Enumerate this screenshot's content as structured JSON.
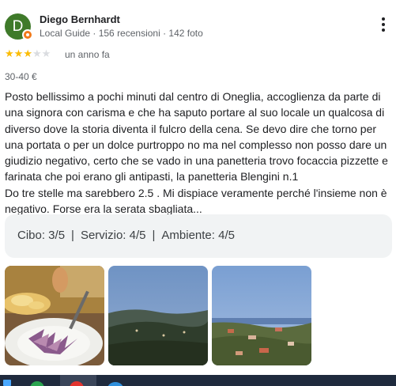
{
  "reviewer": {
    "initial": "D",
    "name": "Diego Bernhardt",
    "meta": "Local Guide · 156 recensioni · 142 foto",
    "avatar_color": "#3f7a2a",
    "badge_color": "#f27a1a"
  },
  "review": {
    "rating": 3,
    "rating_max": 5,
    "star_color": "#fbbc04",
    "time": "un anno fa",
    "price": "30-40 €",
    "text_lines": [
      "Posto bellissimo a pochi minuti dal centro di Oneglia, accoglienza da parte di",
      "una signora con carisma e che ha saputo portare al suo locale un qualcosa di",
      "diverso dove la storia diventa il fulcro della cena. Se devo dire che torno per",
      "una portata o per un dolce purtroppo no ma nel complesso non posso dare un",
      "giudizio negativo, certo che se vado in una panetteria trovo focaccia pizzette e",
      "farinata che poi erano gli antipasti, la panetteria Blengini n.1",
      "Do tre stelle ma sarebbero 2.5 . Mi dispiace veramente perché l'insieme non è",
      "negativo. Forse era la serata sbagliata..."
    ],
    "sub_ratings": {
      "cibo": "Cibo: 3/5",
      "servizio": "Servizio: 4/5",
      "ambiente": "Ambiente: 4/5",
      "separator": "|"
    }
  },
  "photos": [
    {
      "name": "food-photo",
      "subject": "salad plate with bread basket"
    },
    {
      "name": "landscape-photo-dusk",
      "subject": "hills at dusk"
    },
    {
      "name": "landscape-photo-village",
      "subject": "village and sea view"
    }
  ],
  "icons": {
    "more": "more-vert-icon",
    "badge": "local-guide-badge-icon"
  },
  "taskbar": {
    "icons": [
      "windows-start-icon",
      "chrome-icon",
      "opera-icon",
      "edge-icon"
    ],
    "color": "#1f2a3d"
  }
}
